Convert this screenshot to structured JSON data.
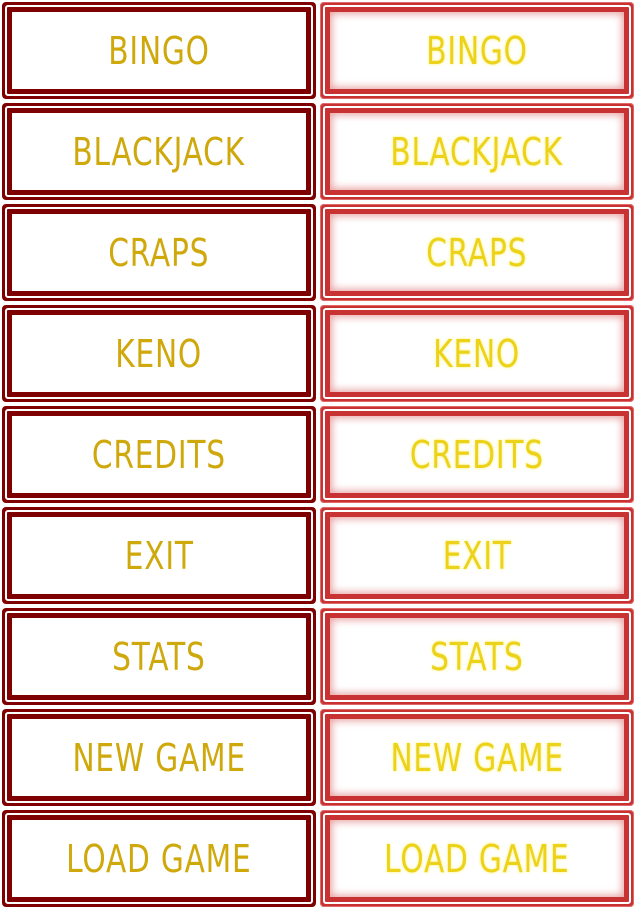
{
  "buttons": [
    {
      "label": "BINGO"
    },
    {
      "label": "BLACKJACK"
    },
    {
      "label": "CRAPS"
    },
    {
      "label": "KENO"
    },
    {
      "label": "CREDITS"
    },
    {
      "label": "EXIT"
    },
    {
      "label": "STATS"
    },
    {
      "label": "NEW GAME"
    },
    {
      "label": "LOAD GAME"
    }
  ],
  "colors": {
    "normal_frame": "#7e0000",
    "normal_text": "#cfa80c",
    "hover_frame": "#c83232",
    "hover_text": "#ecd21a"
  }
}
